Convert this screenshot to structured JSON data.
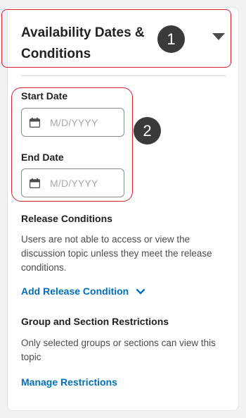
{
  "section": {
    "title": "Availability Dates & Conditions",
    "collapse_icon": "caret-down-icon"
  },
  "badges": [
    "1",
    "2"
  ],
  "start_date": {
    "label": "Start Date",
    "placeholder": "M/D/YYYY",
    "icon": "calendar-icon"
  },
  "end_date": {
    "label": "End Date",
    "placeholder": "M/D/YYYY",
    "icon": "calendar-icon"
  },
  "release_conditions": {
    "heading": "Release Conditions",
    "description": "Users are not able to access or view the discussion topic unless they meet the release conditions.",
    "add_label": "Add Release Condition",
    "add_icon": "chevron-down-icon"
  },
  "restrictions": {
    "heading": "Group and Section Restrictions",
    "description": "Only selected groups or sections can view this topic",
    "manage_label": "Manage Restrictions"
  },
  "colors": {
    "highlight": "#d8202b",
    "link": "#006fbf",
    "badge": "#3a3a3a"
  }
}
